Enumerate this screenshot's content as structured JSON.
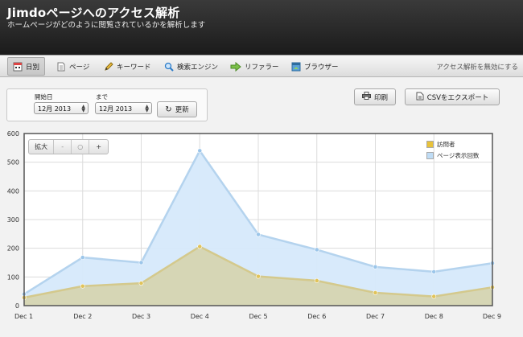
{
  "header": {
    "title": "Jimdoページへのアクセス解析",
    "subtitle": "ホームページがどのように閲覧されているかを解析します"
  },
  "tabs": [
    {
      "label": "日別",
      "icon": "calendar-icon",
      "active": true
    },
    {
      "label": "ページ",
      "icon": "page-icon"
    },
    {
      "label": "キーワード",
      "icon": "pencil-icon"
    },
    {
      "label": "検索エンジン",
      "icon": "magnifier-icon"
    },
    {
      "label": "リファラー",
      "icon": "arrow-icon"
    },
    {
      "label": "ブラウザー",
      "icon": "browser-icon"
    }
  ],
  "disable_link": "アクセス解析を無効にする",
  "filter": {
    "start_label": "開始日",
    "end_label": "まで",
    "start_value": "12月 2013",
    "end_value": "12月 2013",
    "update_label": "更新"
  },
  "actions": {
    "print_label": "印刷",
    "export_label": "CSVをエクスポート"
  },
  "zoom": {
    "label": "拡大",
    "minus": "-",
    "reset": "○",
    "plus": "+"
  },
  "colors": {
    "visitors": "#e8c23a",
    "pageviews": "#bfdcf5",
    "visitors_area": "#d6d2a8",
    "pageviews_area": "#d6e9fb"
  },
  "chart_data": {
    "type": "area",
    "categories": [
      "Dec 1",
      "Dec 2",
      "Dec 3",
      "Dec 4",
      "Dec 5",
      "Dec 6",
      "Dec 7",
      "Dec 8",
      "Dec 9"
    ],
    "series": [
      {
        "name": "ページ表示回数",
        "values": [
          40,
          168,
          150,
          540,
          248,
          195,
          135,
          118,
          148
        ]
      },
      {
        "name": "訪問者",
        "values": [
          28,
          68,
          78,
          206,
          102,
          87,
          45,
          32,
          64
        ]
      }
    ],
    "y_ticks": [
      "0",
      "100",
      "200",
      "300",
      "400",
      "500",
      "600"
    ],
    "ylim": [
      0,
      600
    ],
    "grid": true,
    "legend": "top-right"
  }
}
